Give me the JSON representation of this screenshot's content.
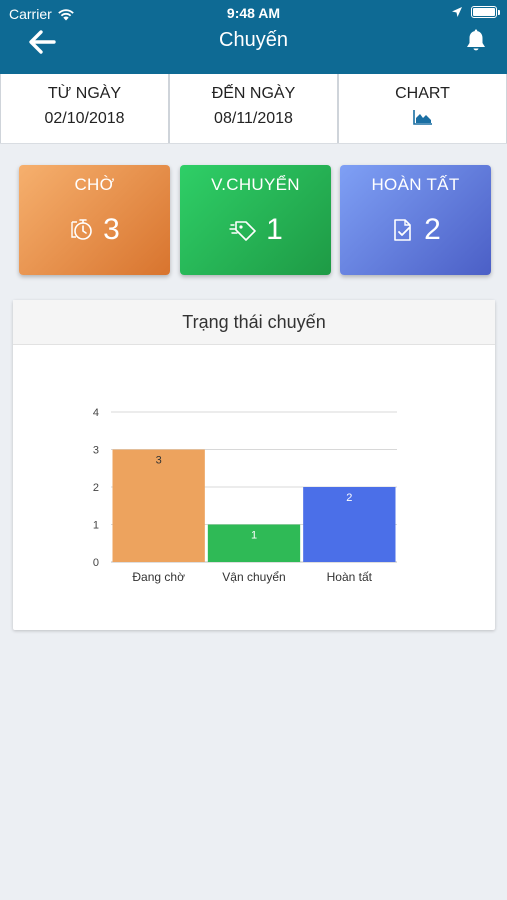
{
  "status_bar": {
    "carrier": "Carrier",
    "time": "9:48 AM"
  },
  "nav": {
    "title": "Chuyến",
    "back_icon": "arrow-left-icon",
    "bell_icon": "bell-icon"
  },
  "tabs": [
    {
      "label": "TỪ NGÀY",
      "value": "02/10/2018"
    },
    {
      "label": "ĐẾN NGÀY",
      "value": "08/11/2018"
    },
    {
      "label": "CHART",
      "icon": "area-chart-icon"
    }
  ],
  "cards": [
    {
      "label": "CHỜ",
      "count": "3",
      "icon": "timer-icon",
      "color": "#e89049"
    },
    {
      "label": "V.CHUYỂN",
      "count": "1",
      "icon": "shipping-icon",
      "color": "#27b556"
    },
    {
      "label": "HOÀN TẤT",
      "count": "2",
      "icon": "document-check-icon",
      "color": "#6680e0"
    }
  ],
  "panel": {
    "title": "Trạng thái chuyến"
  },
  "chart_data": {
    "type": "bar",
    "title": "Trạng thái chuyến",
    "categories": [
      "Đang chờ",
      "Vận chuyển",
      "Hoàn tất"
    ],
    "values": [
      3,
      1,
      2
    ],
    "data_labels": [
      "3",
      "1",
      "2"
    ],
    "colors": [
      "#eda35e",
      "#2fba56",
      "#4b6fe8"
    ],
    "ylim": [
      0,
      4
    ],
    "yticks": [
      "0",
      "1",
      "2",
      "3",
      "4"
    ],
    "grid": true,
    "xlabel": "",
    "ylabel": ""
  }
}
